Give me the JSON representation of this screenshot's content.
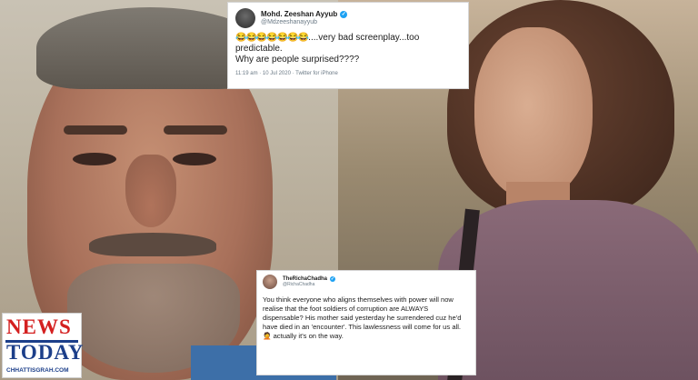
{
  "tweet_top": {
    "display_name": "Mohd. Zeeshan Ayyub",
    "handle": "@Mdzeeshanayyub",
    "emojis": "😂😂😂😂😂😂😂",
    "text_line1": "....very bad screenplay...too predictable.",
    "text_line2": "Why are people surprised????",
    "meta": "11:19 am · 10 Jul 2020 · Twitter for iPhone",
    "verified_mark": "✓"
  },
  "tweet_bottom": {
    "display_name": "TheRichaChadha",
    "handle": "@RichaChadha",
    "text": "You think everyone who aligns themselves with power will now realise that the foot soldiers of corruption are ALWAYS dispensable? His mother said yesterday he surrendered cuz he'd have died in an 'encounter'. This lawlessness will come for us all. 🤦 actually it's on the way.",
    "verified_mark": "✓"
  },
  "logo": {
    "word1": "NEWS",
    "word2": "TODAY",
    "site": "CHHATTISGRAH.COM"
  },
  "colors": {
    "logo_red": "#d42020",
    "logo_blue": "#1c3f8a",
    "verified_blue": "#1da1f2"
  }
}
